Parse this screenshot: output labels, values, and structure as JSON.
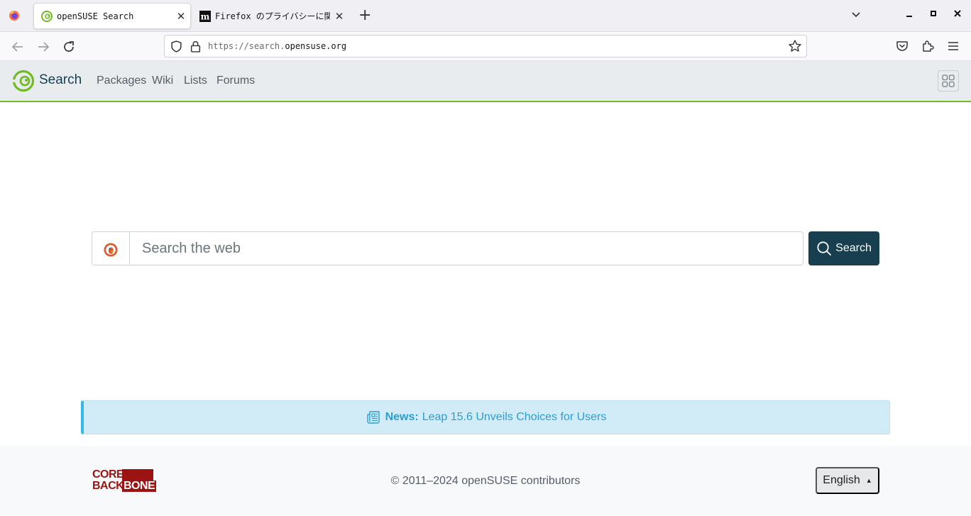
{
  "browser": {
    "tabs": [
      {
        "title": "openSUSE Search",
        "active": true,
        "favicon": "opensuse-icon"
      },
      {
        "title": "Firefox のプライバシーに関",
        "active": false,
        "favicon": "mdn-icon"
      }
    ],
    "new_tab_label": "+",
    "url": {
      "scheme": "https://search.",
      "domain": "opensuse.org"
    }
  },
  "site": {
    "brand": "Search",
    "nav": [
      "Packages",
      "Wiki",
      "Lists",
      "Forums"
    ]
  },
  "search": {
    "placeholder": "Search the web",
    "button_label": "Search",
    "engine_icon": "duckduckgo-icon"
  },
  "news": {
    "label": "News:",
    "headline": "Leap 15.6 Unveils Choices for Users"
  },
  "footer": {
    "logo_line1": "CORE",
    "logo_line2a": "BACK",
    "logo_line2b": "BONE",
    "copyright": "© 2011–2024 openSUSE contributors",
    "language": "English"
  },
  "colors": {
    "accent_green": "#73ba25",
    "brand_dark": "#173f4f",
    "news_blue": "#2a9fd6",
    "core_red": "#9b1313"
  }
}
